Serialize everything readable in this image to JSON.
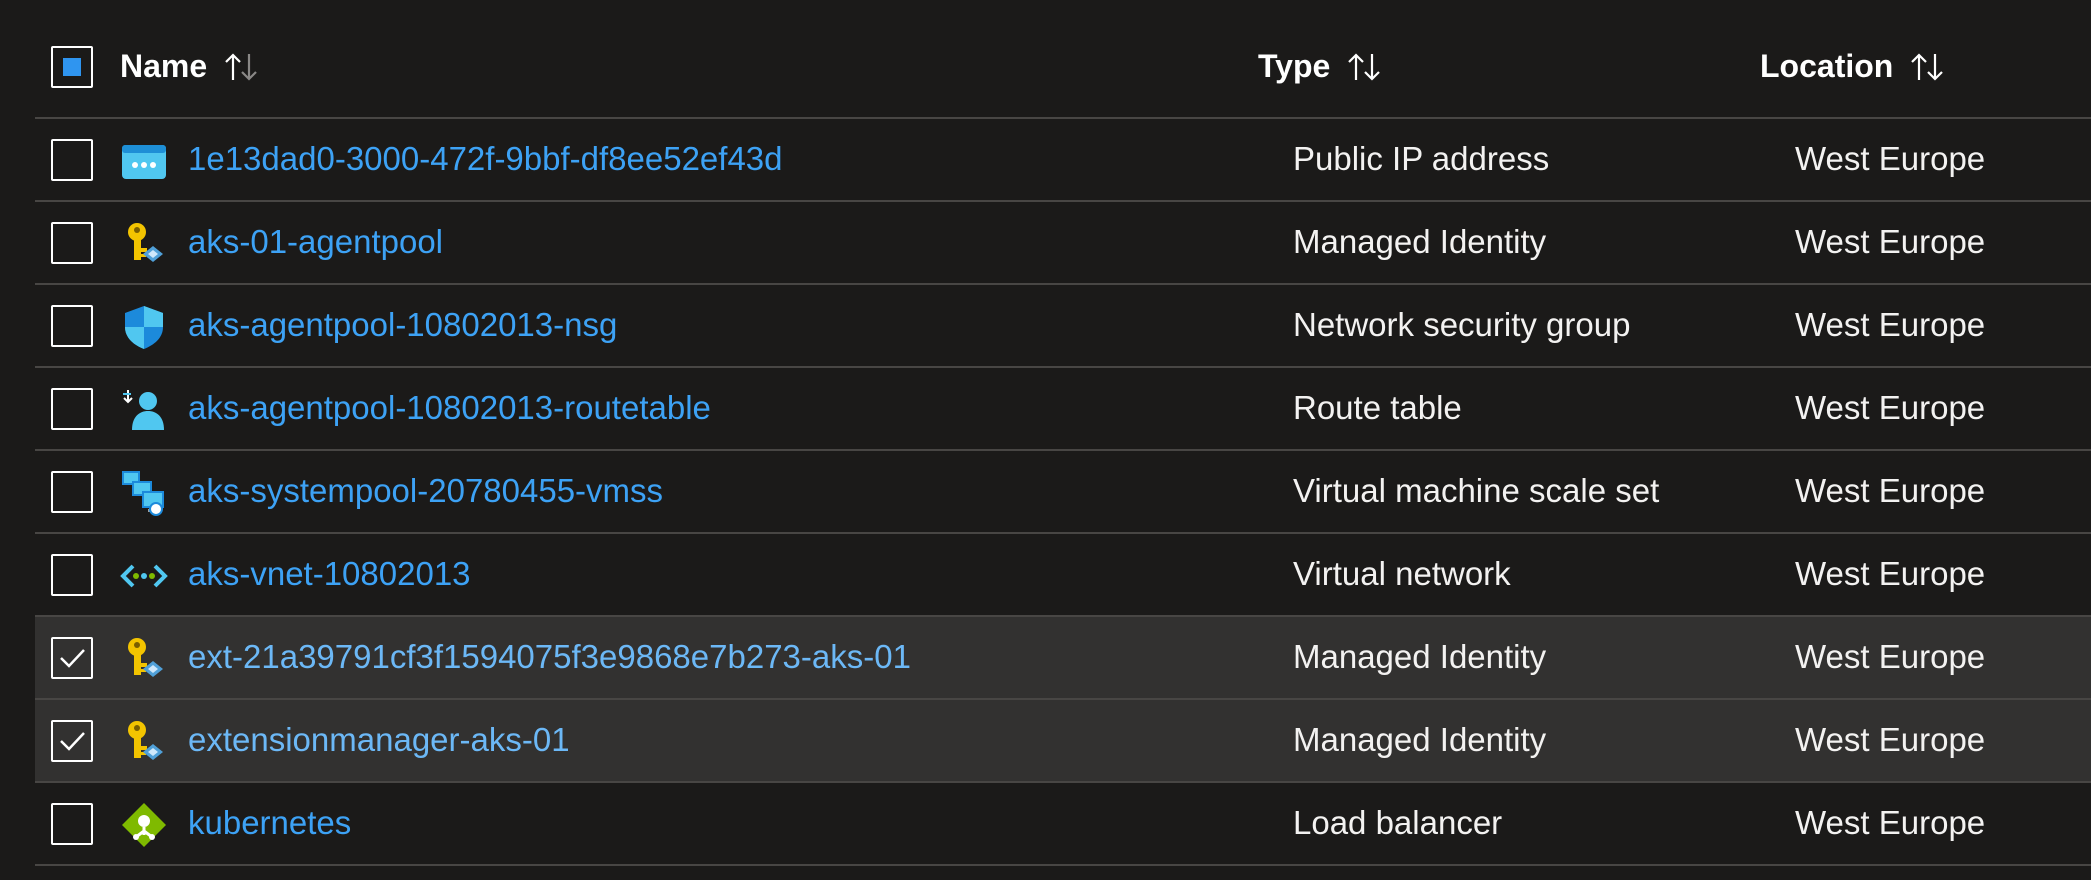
{
  "header": {
    "name_label": "Name",
    "type_label": "Type",
    "location_label": "Location"
  },
  "rows": [
    {
      "name": "1e13dad0-3000-472f-9bbf-df8ee52ef43d",
      "type": "Public IP address",
      "location": "West Europe",
      "icon": "public-ip-icon",
      "selected": false
    },
    {
      "name": "aks-01-agentpool",
      "type": "Managed Identity",
      "location": "West Europe",
      "icon": "managed-identity-icon",
      "selected": false
    },
    {
      "name": "aks-agentpool-10802013-nsg",
      "type": "Network security group",
      "location": "West Europe",
      "icon": "network-security-group-icon",
      "selected": false
    },
    {
      "name": "aks-agentpool-10802013-routetable",
      "type": "Route table",
      "location": "West Europe",
      "icon": "route-table-icon",
      "selected": false
    },
    {
      "name": "aks-systempool-20780455-vmss",
      "type": "Virtual machine scale set",
      "location": "West Europe",
      "icon": "vmss-icon",
      "selected": false
    },
    {
      "name": "aks-vnet-10802013",
      "type": "Virtual network",
      "location": "West Europe",
      "icon": "virtual-network-icon",
      "selected": false
    },
    {
      "name": "ext-21a39791cf3f1594075f3e9868e7b273-aks-01",
      "type": "Managed Identity",
      "location": "West Europe",
      "icon": "managed-identity-icon",
      "selected": true
    },
    {
      "name": "extensionmanager-aks-01",
      "type": "Managed Identity",
      "location": "West Europe",
      "icon": "managed-identity-icon",
      "selected": true
    },
    {
      "name": "kubernetes",
      "type": "Load balancer",
      "location": "West Europe",
      "icon": "load-balancer-icon",
      "selected": false
    }
  ],
  "colors": {
    "background": "#1b1a19",
    "selected_row": "#323130",
    "link": "#3da2f5",
    "accent": "#2f95f0"
  }
}
